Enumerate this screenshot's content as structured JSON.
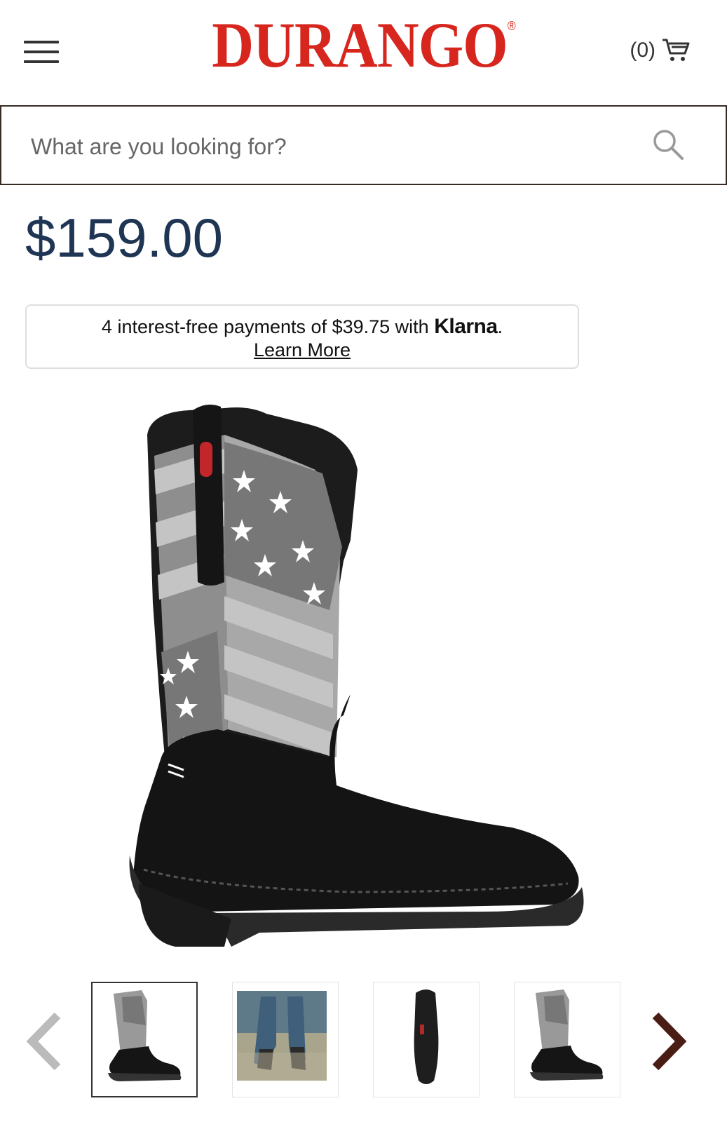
{
  "header": {
    "logo_text": "DURANGO",
    "registered_mark": "®",
    "cart_count": "(0)",
    "brand_color": "#d7261e"
  },
  "search": {
    "placeholder": "What are you looking for?"
  },
  "product": {
    "price": "$159.00",
    "price_color": "#1f3554"
  },
  "klarna": {
    "text_prefix": "4 interest-free payments of $39.75 with ",
    "brand": "Klarna",
    "text_suffix": ".",
    "learn_more": "Learn More"
  },
  "gallery": {
    "active_index": 0,
    "thumbnails": [
      "boot-side-view",
      "boots-worn-outdoors",
      "boot-sole-view",
      "boot-side-view-alt"
    ]
  },
  "icons": {
    "menu": "hamburger-icon",
    "cart": "cart-icon",
    "search": "search-icon",
    "prev": "chevron-left-icon",
    "next": "chevron-right-icon"
  }
}
